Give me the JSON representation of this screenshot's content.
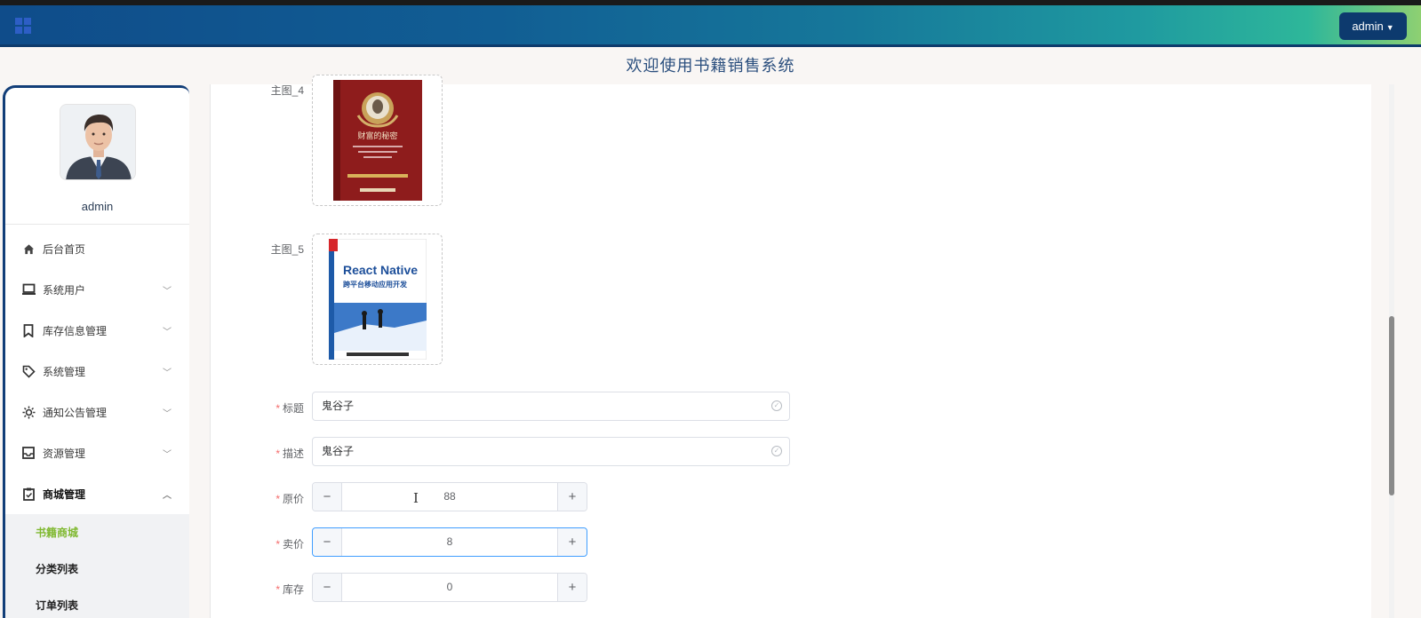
{
  "header": {
    "user_menu_label": "admin",
    "welcome_text": "欢迎使用书籍销售系统"
  },
  "sidebar": {
    "username": "admin",
    "items": [
      {
        "label": "后台首页",
        "icon": "home-icon"
      },
      {
        "label": "系统用户",
        "icon": "laptop-icon"
      },
      {
        "label": "库存信息管理",
        "icon": "bookmark-icon"
      },
      {
        "label": "系统管理",
        "icon": "tag-icon"
      },
      {
        "label": "通知公告管理",
        "icon": "sun-icon"
      },
      {
        "label": "资源管理",
        "icon": "inbox-icon"
      },
      {
        "label": "商城管理",
        "icon": "clipboard-icon"
      }
    ],
    "submenu": [
      {
        "label": "书籍商城",
        "current": true
      },
      {
        "label": "分类列表",
        "current": false
      },
      {
        "label": "订单列表",
        "current": false
      }
    ]
  },
  "form": {
    "image4_label": "主图_4",
    "image4_title": "财富的秘密",
    "image5_label": "主图_5",
    "image5_title": "React Native",
    "image5_subtitle": "跨平台移动应用开发",
    "title": {
      "label": "标题",
      "value": "鬼谷子"
    },
    "description": {
      "label": "描述",
      "value": "鬼谷子"
    },
    "original_price": {
      "label": "原价",
      "value": "88"
    },
    "sale_price": {
      "label": "卖价",
      "value": "8"
    },
    "stock": {
      "label": "库存",
      "value": "0"
    },
    "minus_symbol": "−",
    "plus_symbol": "+",
    "required_mark": "*"
  },
  "colors": {
    "accent_active": "#7fb82f",
    "header_dark": "#0d3a6e",
    "focus_border": "#409eff",
    "required": "#f56c6c"
  }
}
